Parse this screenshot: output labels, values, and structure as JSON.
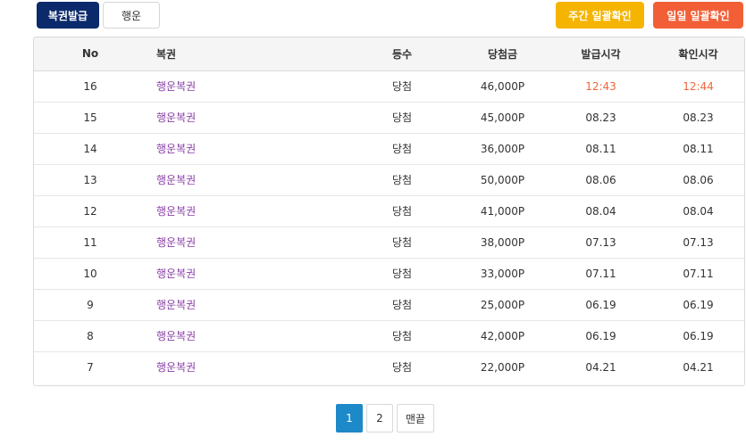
{
  "top_buttons": {
    "issue": "복권발급",
    "luck": "행운",
    "weekly_confirm": "주간 일괄확인",
    "daily_confirm": "일일 일괄확인"
  },
  "colors": {
    "issue_button": "#0b2a6b",
    "weekly_button": "#f5b400",
    "daily_button": "#f25f37",
    "lottery_link": "#8a3fa6",
    "highlight_time": "#f0663b",
    "active_page": "#1d89c9"
  },
  "table": {
    "headers": {
      "no": "No",
      "name": "복권",
      "rank": "등수",
      "prize": "당첨금",
      "issued_at": "발급시각",
      "checked_at": "확인시각"
    },
    "rows": [
      {
        "no": "16",
        "name": "행운복권",
        "rank": "당첨",
        "prize": "46,000P",
        "issued_at": "12:43",
        "checked_at": "12:44"
      },
      {
        "no": "15",
        "name": "행운복권",
        "rank": "당첨",
        "prize": "45,000P",
        "issued_at": "08.23",
        "checked_at": "08.23"
      },
      {
        "no": "14",
        "name": "행운복권",
        "rank": "당첨",
        "prize": "36,000P",
        "issued_at": "08.11",
        "checked_at": "08.11"
      },
      {
        "no": "13",
        "name": "행운복권",
        "rank": "당첨",
        "prize": "50,000P",
        "issued_at": "08.06",
        "checked_at": "08.06"
      },
      {
        "no": "12",
        "name": "행운복권",
        "rank": "당첨",
        "prize": "41,000P",
        "issued_at": "08.04",
        "checked_at": "08.04"
      },
      {
        "no": "11",
        "name": "행운복권",
        "rank": "당첨",
        "prize": "38,000P",
        "issued_at": "07.13",
        "checked_at": "07.13"
      },
      {
        "no": "10",
        "name": "행운복권",
        "rank": "당첨",
        "prize": "33,000P",
        "issued_at": "07.11",
        "checked_at": "07.11"
      },
      {
        "no": "9",
        "name": "행운복권",
        "rank": "당첨",
        "prize": "25,000P",
        "issued_at": "06.19",
        "checked_at": "06.19"
      },
      {
        "no": "8",
        "name": "행운복권",
        "rank": "당첨",
        "prize": "42,000P",
        "issued_at": "06.19",
        "checked_at": "06.19"
      },
      {
        "no": "7",
        "name": "행운복권",
        "rank": "당첨",
        "prize": "22,000P",
        "issued_at": "04.21",
        "checked_at": "04.21"
      }
    ]
  },
  "pagination": {
    "pages": [
      "1",
      "2"
    ],
    "current": "1",
    "last_label": "맨끝"
  }
}
